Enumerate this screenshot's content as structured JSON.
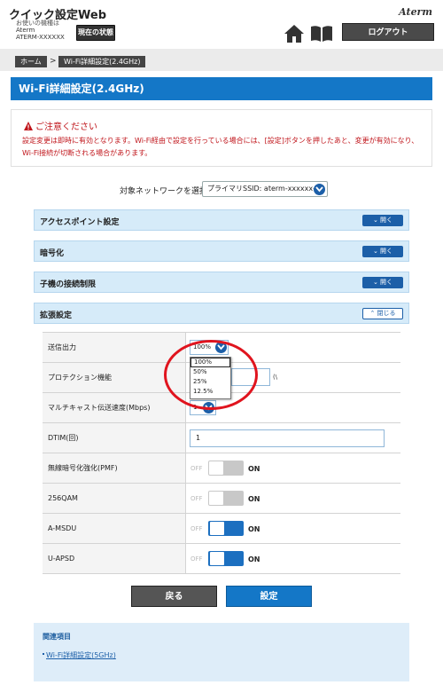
{
  "header": {
    "app_title": "クイック設定Web",
    "device_label": "お使いの機種は",
    "device_name": "Aterm",
    "device_model": "ATERM-XXXXXX",
    "status_button": "現在の状態",
    "brand": "Aterm",
    "logout_button": "ログアウト"
  },
  "breadcrumb": {
    "home": "ホーム",
    "separator": ">",
    "current": "Wi-Fi詳細設定(2.4GHz)"
  },
  "page_title": "Wi-Fi詳細設定(2.4GHz)",
  "notice": {
    "title": "ご注意ください",
    "text": "設定変更は即時に有効となります。Wi-Fi経由で設定を行っている場合には、[設定]ボタンを押したあと、変更が有効になり、Wi-Fi接続が切断される場合があります。"
  },
  "network": {
    "label": "対象ネットワークを選択",
    "selected": "プライマリSSID: aterm-xxxxxx-x"
  },
  "sections": [
    {
      "label": "アクセスポイント設定",
      "button": "開く"
    },
    {
      "label": "暗号化",
      "button": "開く"
    },
    {
      "label": "子機の接続制限",
      "button": "開く"
    },
    {
      "label": "拡張設定",
      "button": "閉じる"
    }
  ],
  "settings": {
    "tx_power": {
      "label": "送信出力",
      "value": "100%"
    },
    "protection": {
      "label": "プロテクション機能",
      "suffix": "(\\"
    },
    "multicast": {
      "label": "マルチキャスト伝送速度(Mbps)",
      "value": "1"
    },
    "dtim": {
      "label": "DTIM(回)",
      "value": "1"
    },
    "pmf": {
      "label": "無線暗号化強化(PMF)",
      "off": "OFF",
      "on": "ON",
      "state": "off"
    },
    "qam256": {
      "label": "256QAM",
      "off": "OFF",
      "on": "ON",
      "state": "off"
    },
    "amsdu": {
      "label": "A-MSDU",
      "off": "OFF",
      "on": "ON",
      "state": "on"
    },
    "uapsd": {
      "label": "U-APSD",
      "off": "OFF",
      "on": "ON",
      "state": "on"
    }
  },
  "dropdown": {
    "options": [
      "100%",
      "50%",
      "25%",
      "12.5%"
    ],
    "selected_index": 0
  },
  "actions": {
    "back": "戻る",
    "submit": "設定"
  },
  "related": {
    "title": "関連項目",
    "link": "Wi-Fi詳細設定(5GHz)"
  },
  "colors": {
    "primary": "#1477c7",
    "warning": "#c0151b",
    "highlight": "#e0141e",
    "switch_on": "#1c6fc0",
    "switch_off": "#c8c8c8"
  }
}
